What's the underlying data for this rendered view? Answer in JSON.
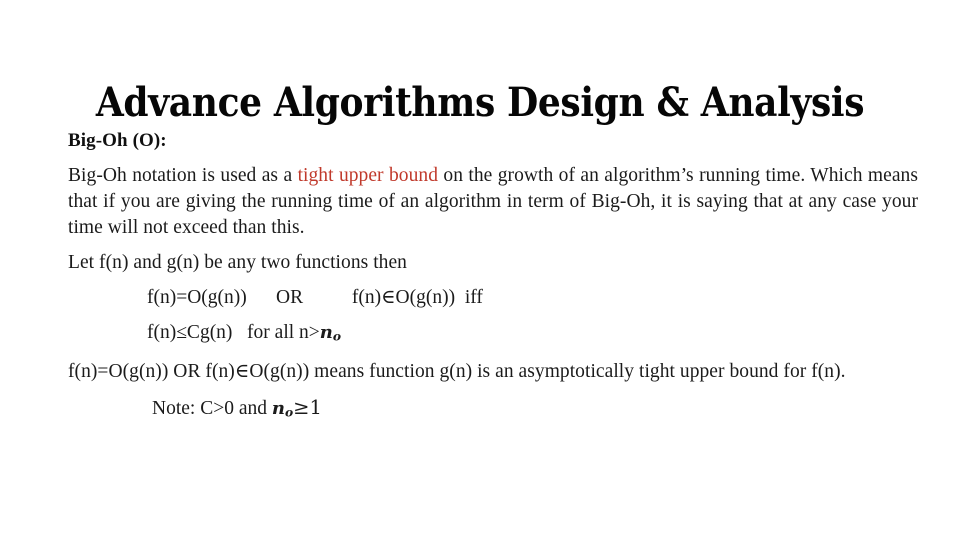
{
  "slide": {
    "title": "Advance Algorithms Design & Analysis",
    "background_color": "#ffffff",
    "text_color": "#1b1b1b",
    "accent_color": "#c0392b"
  },
  "content": {
    "heading": "Big-Oh (O):",
    "paragraph_1": {
      "part_1": "Big-Oh notation is used as a ",
      "highlight": "tight upper bound",
      "part_2": " on the growth of an algorithm’s running time. Which means that if you are giving the running time of an algorithm in term of Big-Oh, it is saying that at any case your time will not exceed than this."
    },
    "let_line": "Let f(n) and g(n) be any two functions then",
    "formula_1": "f(n)=O(g(n))      OR          f(n)∈O(g(n))  iff",
    "formula_2": {
      "lead": "f(n)≤Cg(n)   for all n>",
      "variable": "n",
      "subscript": "o"
    },
    "paragraph_2": "f(n)=O(g(n))  OR  f(n)∈O(g(n))  means function g(n) is an asymptotically tight upper bound for f(n).",
    "note": {
      "lead": "Note: C>0 and ",
      "variable": "n",
      "subscript": "o",
      "trail": "≥1"
    }
  }
}
